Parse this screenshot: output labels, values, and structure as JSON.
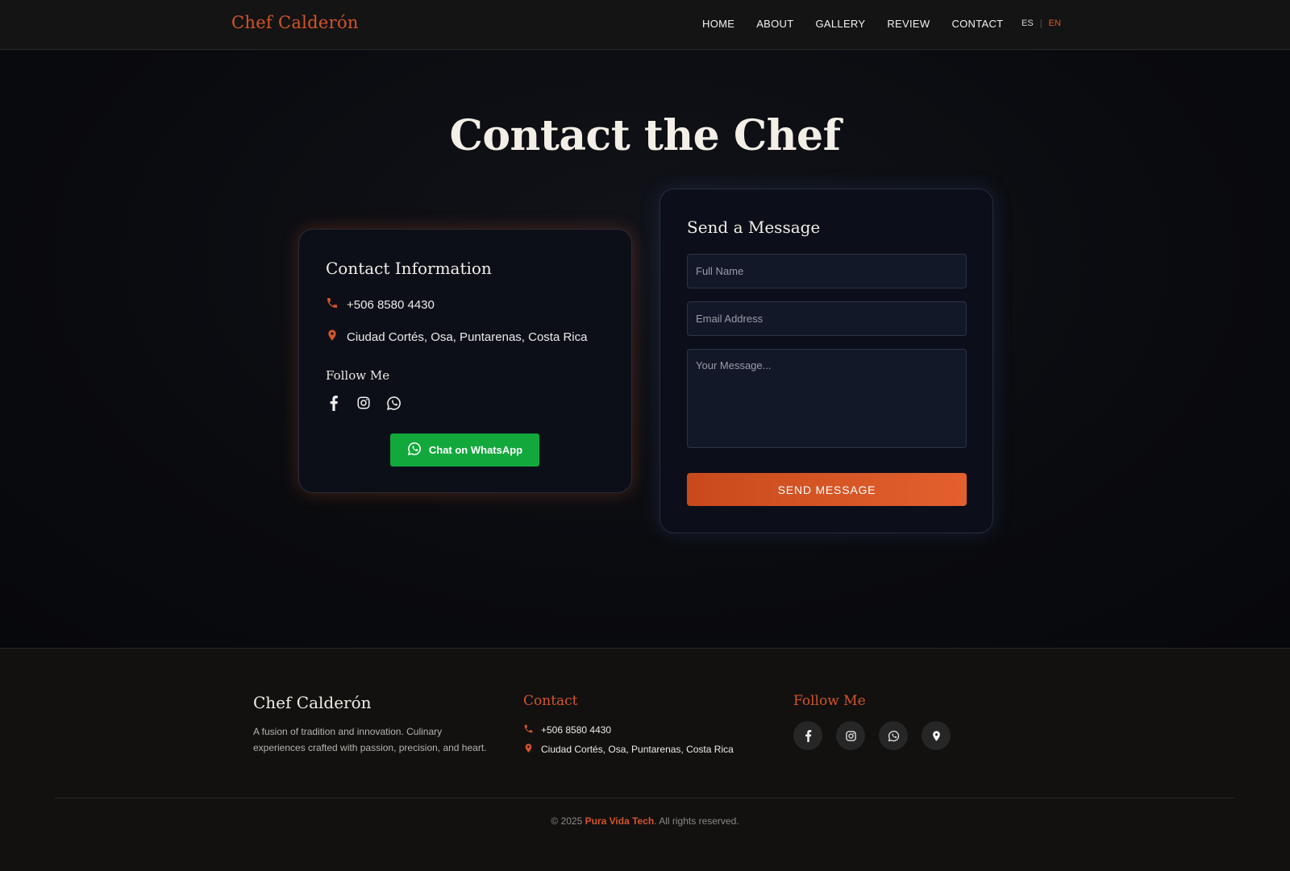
{
  "nav": {
    "brand": "Chef Calderón",
    "links": [
      "HOME",
      "ABOUT",
      "GALLERY",
      "REVIEW",
      "CONTACT"
    ],
    "lang_es": "ES",
    "lang_sep": "|",
    "lang_en": "EN"
  },
  "hero": {
    "title": "Contact the Chef"
  },
  "contact_card": {
    "title": "Contact Information",
    "phone": "+506 8580 4430",
    "address": "Ciudad Cortés, Osa, Puntarenas, Costa Rica",
    "follow_label": "Follow Me",
    "social_icons": [
      "facebook-icon",
      "instagram-icon",
      "whatsapp-icon"
    ],
    "whatsapp_button": "Chat on WhatsApp"
  },
  "form": {
    "title": "Send a Message",
    "name_placeholder": "Full Name",
    "email_placeholder": "Email Address",
    "message_placeholder": "Your Message...",
    "submit_label": "SEND MESSAGE"
  },
  "footer": {
    "brand": "Chef Calderón",
    "description": "A fusion of tradition and innovation. Culinary experiences crafted with passion, precision, and heart.",
    "contact_title": "Contact",
    "phone": "+506 8580 4430",
    "address": "Ciudad Cortés, Osa, Puntarenas, Costa Rica",
    "follow_title": "Follow Me",
    "social_icons": [
      "facebook-icon",
      "instagram-icon",
      "whatsapp-icon",
      "map-pin-icon"
    ],
    "copyright_prefix": "© 2025",
    "company": "Pura Vida Tech",
    "copyright_suffix": ". All rights reserved."
  },
  "colors": {
    "accent": "#d4542a",
    "whatsapp_green": "#13a83c",
    "background": "#0b0b0e"
  }
}
